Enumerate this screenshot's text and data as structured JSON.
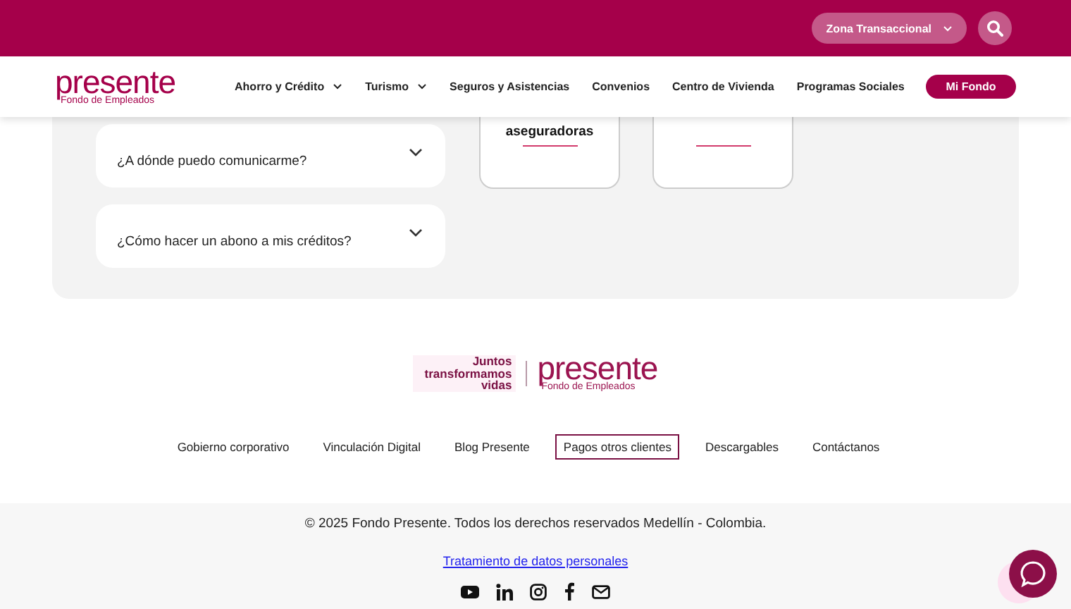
{
  "top_bar": {
    "transactional_button": "Zona Transaccional"
  },
  "header": {
    "logo": {
      "name": "presente",
      "subtitle": "Fondo de Empleados"
    },
    "nav": [
      {
        "label": "Ahorro y Crédito",
        "dropdown": true
      },
      {
        "label": "Turismo",
        "dropdown": true
      },
      {
        "label": "Seguros y Asistencias",
        "dropdown": false
      },
      {
        "label": "Convenios",
        "dropdown": false
      },
      {
        "label": "Centro de Vivienda",
        "dropdown": false
      },
      {
        "label": "Programas Sociales",
        "dropdown": false
      }
    ],
    "account_button": "Mi Fondo"
  },
  "faq": [
    {
      "question": "¿A dónde puedo comunicarme?",
      "expanded": false
    },
    {
      "question": "¿Cómo hacer un abono a mis créditos?",
      "expanded": false
    }
  ],
  "cards": [
    {
      "kind": "titled",
      "title": "aseguradoras"
    },
    {
      "kind": "blank"
    }
  ],
  "footer": {
    "tagline": [
      "Juntos",
      "transformamos",
      "vidas"
    ],
    "logo": {
      "name": "presente",
      "subtitle": "Fondo de Empleados"
    },
    "links": [
      {
        "label": "Gobierno corporativo",
        "focused": false
      },
      {
        "label": "Vinculación Digital",
        "focused": false
      },
      {
        "label": "Blog Presente",
        "focused": false
      },
      {
        "label": "Pagos otros clientes",
        "focused": true
      },
      {
        "label": "Descargables",
        "focused": false
      },
      {
        "label": "Contáctanos",
        "focused": false
      }
    ],
    "copyright": "© 2025 Fondo Presente. Todos los derechos reservados Medellín - Colombia.",
    "privacy_link": "Tratamiento de datos personales",
    "social": [
      {
        "kind": "youtube"
      },
      {
        "kind": "linkedin"
      },
      {
        "kind": "instagram"
      },
      {
        "kind": "facebook"
      },
      {
        "kind": "email"
      }
    ]
  }
}
